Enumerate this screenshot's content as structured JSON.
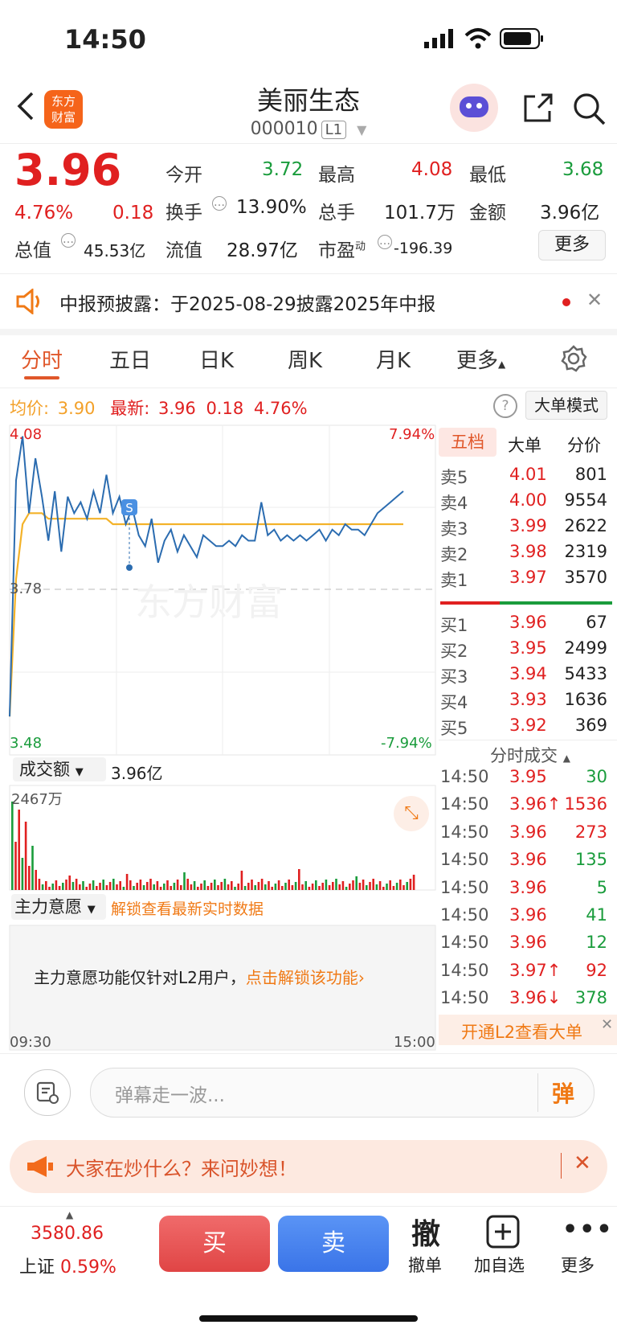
{
  "status_bar": {
    "time": "14:50"
  },
  "header": {
    "logo_text_1": "东方",
    "logo_text_2": "财富",
    "title": "美丽生态",
    "code": "000010",
    "level": "L1"
  },
  "quote": {
    "price": "3.96",
    "change_pct": "4.76%",
    "change": "0.18",
    "open_label": "今开",
    "open": "3.72",
    "high_label": "最高",
    "high": "4.08",
    "low_label": "最低",
    "low": "3.68",
    "turnover_label": "换手",
    "turnover": "13.90%",
    "volume_label": "总手",
    "volume": "101.7万",
    "amount_label": "金额",
    "amount": "3.96亿",
    "mktcap_label": "总值",
    "mktcap": "45.53亿",
    "float_label": "流值",
    "float": "28.97亿",
    "pe_label": "市盈",
    "pe_sup": "动",
    "pe": "-196.39",
    "more": "更多"
  },
  "notice": {
    "text": "中报预披露：于2025-08-29披露2025年中报"
  },
  "tabs": [
    "分时",
    "五日",
    "日K",
    "周K",
    "月K",
    "更多"
  ],
  "info_line": {
    "avg_label": "均价:",
    "avg": "3.90",
    "latest_label": "最新:",
    "latest": "3.96",
    "latest_change": "0.18",
    "latest_pct": "4.76%",
    "big_order_mode": "大单模式"
  },
  "chart_labels": {
    "top_price": "4.08",
    "top_pct": "7.94%",
    "mid_price": "3.78",
    "bottom_price": "3.48",
    "bottom_pct": "-7.94%",
    "marker": "S",
    "watermark": "东方财富",
    "volume_selector": "成交额",
    "volume_total": "3.96亿",
    "volume_max": "2467万",
    "intent_selector": "主力意愿",
    "intent_unlock": "解锁查看最新实时数据",
    "intent_note": "主力意愿功能仅针对L2用户，",
    "intent_link": "点击解锁该功能›",
    "time_start": "09:30",
    "time_end": "15:00"
  },
  "chart_data": {
    "type": "line",
    "x_range": [
      "09:30",
      "15:00"
    ],
    "ylim": [
      3.48,
      4.08
    ],
    "prev_close": 3.78,
    "series": [
      {
        "name": "最新",
        "values": [
          3.55,
          3.98,
          4.06,
          3.92,
          4.02,
          3.95,
          3.87,
          3.96,
          3.85,
          3.95,
          3.92,
          3.94,
          3.91,
          3.96,
          3.92,
          3.99,
          3.92,
          3.95,
          3.9,
          3.93,
          3.88,
          3.86,
          3.91,
          3.83,
          3.87,
          3.89,
          3.85,
          3.88,
          3.86,
          3.84,
          3.88,
          3.87,
          3.86,
          3.86,
          3.87,
          3.86,
          3.88,
          3.87,
          3.87,
          3.94,
          3.88,
          3.89,
          3.87,
          3.88,
          3.87,
          3.88,
          3.87,
          3.88,
          3.89,
          3.87,
          3.89,
          3.88,
          3.9,
          3.89,
          3.89,
          3.88,
          3.9,
          3.92,
          3.93,
          3.94,
          3.95,
          3.96
        ]
      },
      {
        "name": "均价",
        "values": [
          3.55,
          3.8,
          3.9,
          3.92,
          3.92,
          3.92,
          3.91,
          3.91,
          3.91,
          3.91,
          3.91,
          3.91,
          3.91,
          3.91,
          3.91,
          3.91,
          3.9,
          3.9,
          3.9,
          3.9,
          3.9,
          3.9,
          3.9,
          3.9,
          3.9,
          3.9,
          3.9,
          3.9,
          3.9,
          3.9,
          3.9,
          3.9,
          3.9,
          3.9,
          3.9,
          3.9,
          3.9,
          3.9,
          3.9,
          3.9,
          3.9,
          3.9,
          3.9,
          3.9,
          3.9,
          3.9,
          3.9,
          3.9,
          3.9,
          3.9,
          3.9,
          3.9,
          3.9,
          3.9,
          3.9,
          3.9,
          3.9,
          3.9,
          3.9,
          3.9,
          3.9,
          3.9
        ]
      }
    ],
    "volume_max": 2467
  },
  "depth": {
    "tabs": [
      "五档",
      "大单",
      "分价"
    ],
    "asks": [
      {
        "label": "卖5",
        "price": "4.01",
        "vol": "801"
      },
      {
        "label": "卖4",
        "price": "4.00",
        "vol": "9554"
      },
      {
        "label": "卖3",
        "price": "3.99",
        "vol": "2622"
      },
      {
        "label": "卖2",
        "price": "3.98",
        "vol": "2319"
      },
      {
        "label": "卖1",
        "price": "3.97",
        "vol": "3570"
      }
    ],
    "bids": [
      {
        "label": "买1",
        "price": "3.96",
        "vol": "67"
      },
      {
        "label": "买2",
        "price": "3.95",
        "vol": "2499"
      },
      {
        "label": "买3",
        "price": "3.94",
        "vol": "5433"
      },
      {
        "label": "买4",
        "price": "3.93",
        "vol": "1636"
      },
      {
        "label": "买5",
        "price": "3.92",
        "vol": "369"
      }
    ]
  },
  "trades": {
    "title": "分时成交",
    "rows": [
      {
        "time": "14:50",
        "price": "3.95",
        "arrow": "",
        "vol": "30",
        "color": "green"
      },
      {
        "time": "14:50",
        "price": "3.96",
        "arrow": "↑",
        "vol": "1536",
        "color": "red"
      },
      {
        "time": "14:50",
        "price": "3.96",
        "arrow": "",
        "vol": "273",
        "color": "red"
      },
      {
        "time": "14:50",
        "price": "3.96",
        "arrow": "",
        "vol": "135",
        "color": "green"
      },
      {
        "time": "14:50",
        "price": "3.96",
        "arrow": "",
        "vol": "5",
        "color": "green"
      },
      {
        "time": "14:50",
        "price": "3.96",
        "arrow": "",
        "vol": "41",
        "color": "green"
      },
      {
        "time": "14:50",
        "price": "3.96",
        "arrow": "",
        "vol": "12",
        "color": "green"
      },
      {
        "time": "14:50",
        "price": "3.97",
        "arrow": "↑",
        "vol": "92",
        "color": "red"
      },
      {
        "time": "14:50",
        "price": "3.96",
        "arrow": "↓",
        "vol": "378",
        "color": "green"
      }
    ],
    "l2_banner": "开通L2查看大单"
  },
  "comment": {
    "placeholder": "弹幕走一波...",
    "send_label": "弹"
  },
  "ask_banner": {
    "text": "大家在炒什么？来问妙想！"
  },
  "bottom": {
    "index_value": "3580.86",
    "index_name": "上证",
    "index_pct": "0.59%",
    "buy": "买",
    "sell": "卖",
    "cancel_icon": "撤",
    "cancel": "撤单",
    "watch": "加自选",
    "more": "更多"
  },
  "colors": {
    "up": "#e02020",
    "down": "#1a9c3c",
    "accent": "#f07a16",
    "line": "#2b6cb0",
    "avg": "#f3b229"
  }
}
